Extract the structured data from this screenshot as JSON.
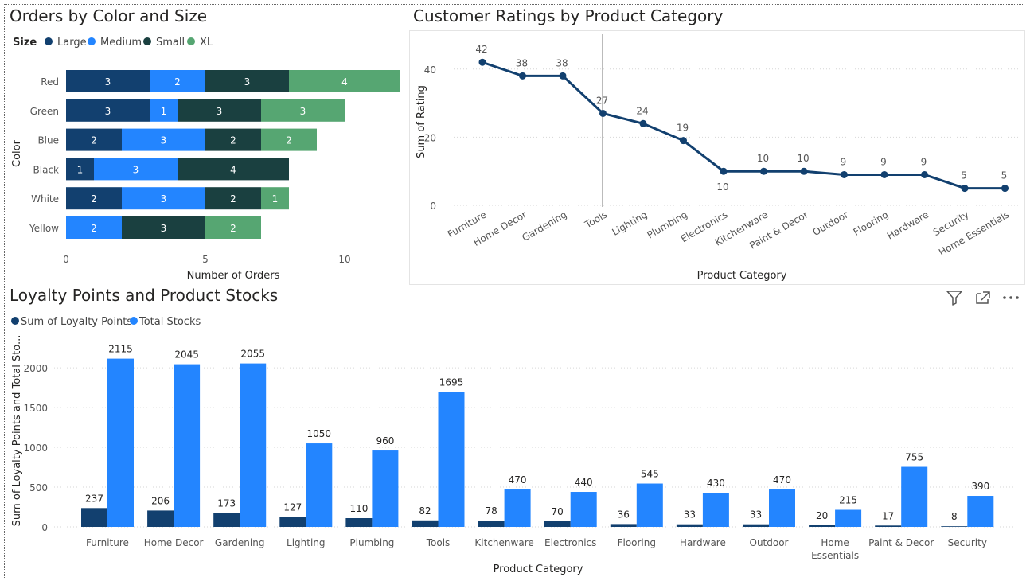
{
  "panels": {
    "orders": {
      "title": "Orders by Color and Size"
    },
    "ratings": {
      "title": "Customer Ratings by Product Category"
    },
    "loyalty": {
      "title": "Loyalty Points and Product Stocks"
    }
  },
  "colors": {
    "large": "#12406f",
    "medium": "#2385ff",
    "small": "#1a4040",
    "xl": "#56a672"
  },
  "icons": [
    "filter-icon",
    "focus-mode-icon",
    "more-options-icon"
  ],
  "chart_data": [
    {
      "id": "orders",
      "type": "bar",
      "orientation": "horizontal",
      "stacked": true,
      "title": "Orders by Color and Size",
      "legend_title": "Size",
      "legend_position": "top-left",
      "categories": [
        "Red",
        "Green",
        "Blue",
        "Black",
        "White",
        "Yellow"
      ],
      "series": [
        {
          "name": "Large",
          "values": [
            3,
            3,
            2,
            1,
            2,
            0
          ]
        },
        {
          "name": "Medium",
          "values": [
            2,
            1,
            3,
            3,
            3,
            2
          ]
        },
        {
          "name": "Small",
          "values": [
            3,
            3,
            2,
            4,
            2,
            3
          ]
        },
        {
          "name": "XL",
          "values": [
            4,
            3,
            2,
            0,
            1,
            2
          ]
        }
      ],
      "xlabel": "Number of Orders",
      "ylabel": "Color",
      "xlim": [
        0,
        12
      ],
      "xticks": [
        0,
        5,
        10
      ],
      "grid": false
    },
    {
      "id": "ratings",
      "type": "line",
      "title": "Customer Ratings by Product Category",
      "categories": [
        "Furniture",
        "Home Decor",
        "Gardening",
        "Tools",
        "Lighting",
        "Plumbing",
        "Electronics",
        "Kitchenware",
        "Paint & Decor",
        "Outdoor",
        "Flooring",
        "Hardware",
        "Security",
        "Home Essentials"
      ],
      "values": [
        42,
        38,
        38,
        27,
        24,
        19,
        10,
        10,
        10,
        9,
        9,
        9,
        5,
        5
      ],
      "xlabel": "Product Category",
      "ylabel": "Sum of Rating",
      "ylim": [
        0,
        50
      ],
      "yticks": [
        0,
        20,
        40
      ],
      "grid": true
    },
    {
      "id": "loyalty",
      "type": "bar",
      "orientation": "vertical",
      "stacked": false,
      "title": "Loyalty Points and Product Stocks",
      "legend_position": "top-left",
      "categories": [
        "Furniture",
        "Home Decor",
        "Gardening",
        "Lighting",
        "Plumbing",
        "Tools",
        "Kitchenware",
        "Electronics",
        "Flooring",
        "Hardware",
        "Outdoor",
        "Home Essentials",
        "Paint & Decor",
        "Security"
      ],
      "category_lines": [
        [
          "Furniture"
        ],
        [
          "Home Decor"
        ],
        [
          "Gardening"
        ],
        [
          "Lighting"
        ],
        [
          "Plumbing"
        ],
        [
          "Tools"
        ],
        [
          "Kitchenware"
        ],
        [
          "Electronics"
        ],
        [
          "Flooring"
        ],
        [
          "Hardware"
        ],
        [
          "Outdoor"
        ],
        [
          "Home",
          "Essentials"
        ],
        [
          "Paint & Decor"
        ],
        [
          "Security"
        ]
      ],
      "series": [
        {
          "name": "Sum of  Loyalty Points",
          "values": [
            237,
            206,
            173,
            127,
            110,
            82,
            78,
            70,
            36,
            33,
            33,
            20,
            17,
            8
          ]
        },
        {
          "name": "Total Stocks",
          "values": [
            2115,
            2045,
            2055,
            1050,
            960,
            1695,
            470,
            440,
            545,
            430,
            470,
            215,
            755,
            390
          ]
        }
      ],
      "xlabel": "Product Category",
      "ylabel": "Sum of Loyalty Points and Total Sto...",
      "ylim": [
        0,
        2300
      ],
      "yticks": [
        0,
        500,
        1000,
        1500,
        2000
      ],
      "grid": true
    }
  ]
}
